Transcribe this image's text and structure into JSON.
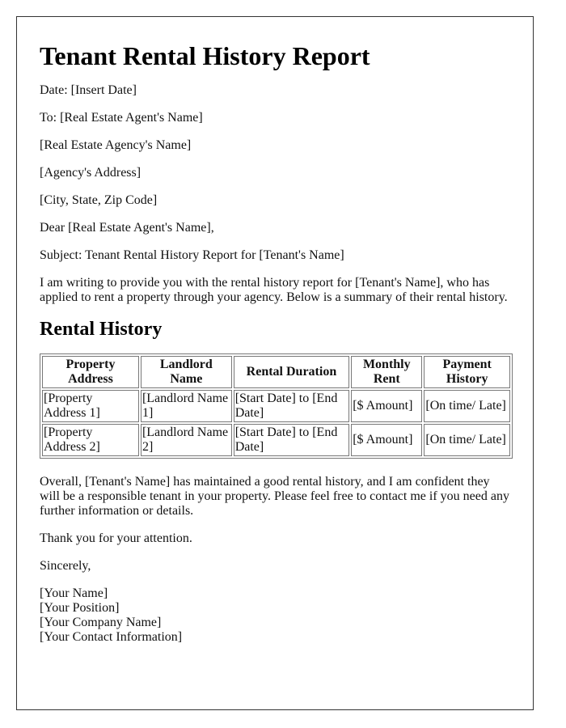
{
  "title": "Tenant Rental History Report",
  "header_lines": [
    "Date: [Insert Date]",
    "To: [Real Estate Agent's Name]",
    "[Real Estate Agency's Name]",
    "[Agency's Address]",
    "[City, State, Zip Code]",
    "Dear [Real Estate Agent's Name],",
    "Subject: Tenant Rental History Report for [Tenant's Name]"
  ],
  "intro": "I am writing to provide you with the rental history report for [Tenant's Name], who has applied to rent a property through your agency. Below is a summary of their rental history.",
  "section_title": "Rental History",
  "table": {
    "headers": [
      "Property Address",
      "Landlord Name",
      "Rental Duration",
      "Monthly Rent",
      "Payment History"
    ],
    "rows": [
      [
        "[Property Address 1]",
        "[Landlord Name 1]",
        "[Start Date] to [End Date]",
        "[$ Amount]",
        "[On time/ Late]"
      ],
      [
        "[Property Address 2]",
        "[Landlord Name 2]",
        "[Start Date] to [End Date]",
        "[$ Amount]",
        "[On time/ Late]"
      ]
    ]
  },
  "closing_paragraph": "Overall, [Tenant's Name] has maintained a good rental history, and I am confident they will be a responsible tenant in your property. Please feel free to contact me if you need any further information or details.",
  "thanks": "Thank you for your attention.",
  "signoff": "Sincerely,",
  "signature": [
    "[Your Name]",
    "[Your Position]",
    "[Your Company Name]",
    "[Your Contact Information]"
  ]
}
